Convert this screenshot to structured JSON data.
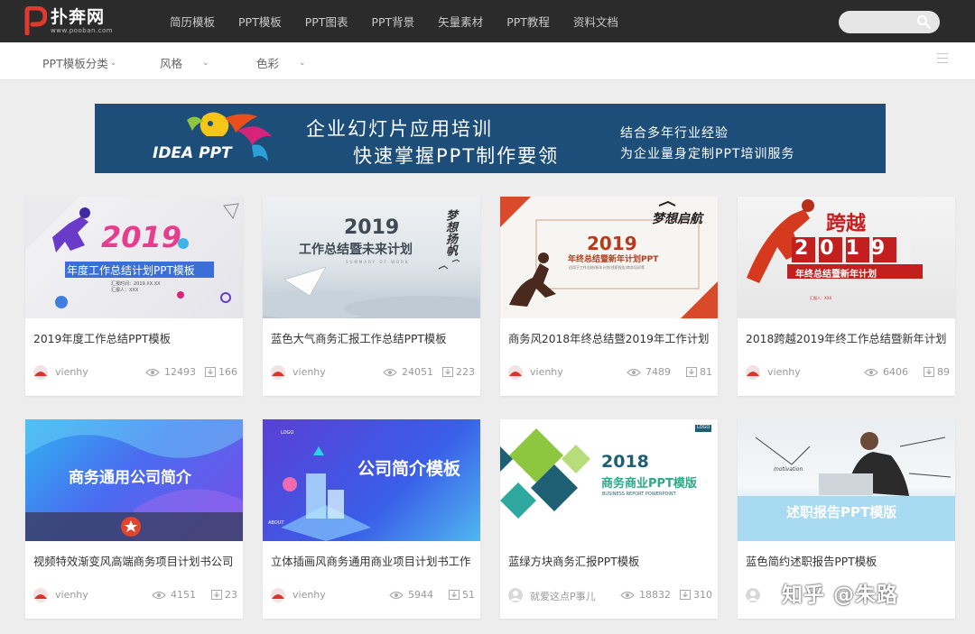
{
  "site": {
    "name": "扑奔网",
    "url": "www.pooban.com"
  },
  "nav": [
    "简历模板",
    "PPT模板",
    "PPT图表",
    "PPT背景",
    "矢量素材",
    "PPT教程",
    "资料文档"
  ],
  "filters": [
    {
      "label": "PPT模板分类"
    },
    {
      "label": "风格"
    },
    {
      "label": "色彩"
    }
  ],
  "banner": {
    "logo_text": "IDEA PPT",
    "line1": "企业幻灯片应用培训",
    "line2": "快速掌握PPT制作要领",
    "right1": "结合多年行业经验",
    "right2": "为企业量身定制PPT培训服务"
  },
  "cards": [
    {
      "title": "2019年度工作总结PPT模板",
      "author": "vienhy",
      "views": "12493",
      "downloads": "166",
      "thumb": {
        "big": "2019",
        "sub": "年度工作总结计划PPT模板",
        "small1": "汇报时间：2019.XX.XX",
        "small2": "汇报人：XXX"
      }
    },
    {
      "title": "蓝色大气商务汇报工作总结PPT模板",
      "author": "vienhy",
      "views": "24051",
      "downloads": "223",
      "thumb": {
        "big": "2019",
        "sub": "工作总结暨未来计划",
        "script": "梦想扬帆",
        "small1": "SUMMARY OF WORK"
      }
    },
    {
      "title": "商务风2018年终总结暨2019年工作计划",
      "author": "vienhy",
      "views": "7489",
      "downloads": "81",
      "thumb": {
        "big": "2019",
        "sub": "年终总结暨新年计划PPT",
        "script": "梦想启航",
        "small1": "适用于工作总结/新年计划/述职报告/商务培训等"
      }
    },
    {
      "title": "2018跨越2019年终工作总结暨新年计划",
      "author": "vienhy",
      "views": "6406",
      "downloads": "89",
      "thumb": {
        "big": "跨越",
        "year": "2019",
        "sub": "年终总结暨新年计划",
        "small1": "汇报人：XXX"
      }
    },
    {
      "title": "视频特效渐变风高端商务项目计划书公司",
      "author": "vienhy",
      "views": "4151",
      "downloads": "23",
      "thumb": {
        "sub": "商务通用公司简介"
      }
    },
    {
      "title": "立体插画风商务通用商业项目计划书工作",
      "author": "vienhy",
      "views": "5944",
      "downloads": "51",
      "thumb": {
        "sub": "公司简介模板",
        "small1": "LOGO",
        "small2": "ABOUT"
      }
    },
    {
      "title": "蓝绿方块商务汇报PPT模板",
      "author": "就爱这点P事儿",
      "views": "18832",
      "downloads": "310",
      "thumb": {
        "big": "2018",
        "sub": "商务商业PPT模版",
        "small1": "BUSINESS REPORT POWERPOINT",
        "small2": "LOGO"
      }
    },
    {
      "title": "蓝色简约述职报告PPT模板",
      "author": "",
      "views": "",
      "downloads": "",
      "thumb": {
        "sub": "述职报告PPT模版",
        "small1": "motivation"
      }
    }
  ],
  "watermark": "知乎 @朱路",
  "colors": {
    "topbar": "#2b2b2b",
    "banner": "#1d4e7a",
    "avatar_red": "#d9352a"
  }
}
